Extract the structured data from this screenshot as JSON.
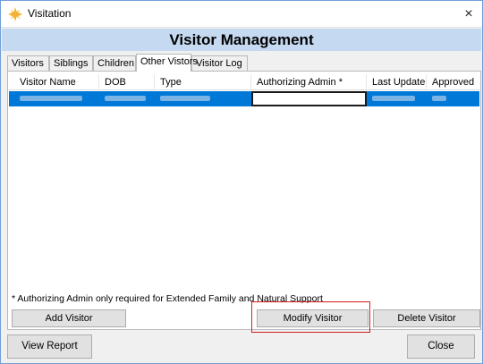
{
  "window": {
    "title": "Visitation",
    "close_glyph": "×"
  },
  "header": {
    "title": "Visitor Management"
  },
  "tabs": [
    {
      "label": "Visitors"
    },
    {
      "label": "Siblings"
    },
    {
      "label": "Children"
    },
    {
      "label": "Other Vistors",
      "active": true
    },
    {
      "label": "Visitor Log"
    }
  ],
  "grid": {
    "columns": [
      "Visitor Name",
      "DOB",
      "Type",
      "Authorizing Admin *",
      "Last Update",
      "Approved"
    ],
    "selected_row_note": "cell contents are blurred/redacted in the screenshot"
  },
  "footnote": "* Authorizing Admin only required for Extended Family and Natural Support",
  "buttons": {
    "add": "Add Visitor",
    "modify": "Modify Visitor",
    "delete": "Delete Visitor",
    "report": "View Report",
    "close": "Close"
  },
  "colors": {
    "header_bg": "#c5d9f1",
    "selection": "#0078d7",
    "highlight": "#d21f1f"
  },
  "icons": {
    "app": "sun-star-icon",
    "close": "close-icon"
  }
}
